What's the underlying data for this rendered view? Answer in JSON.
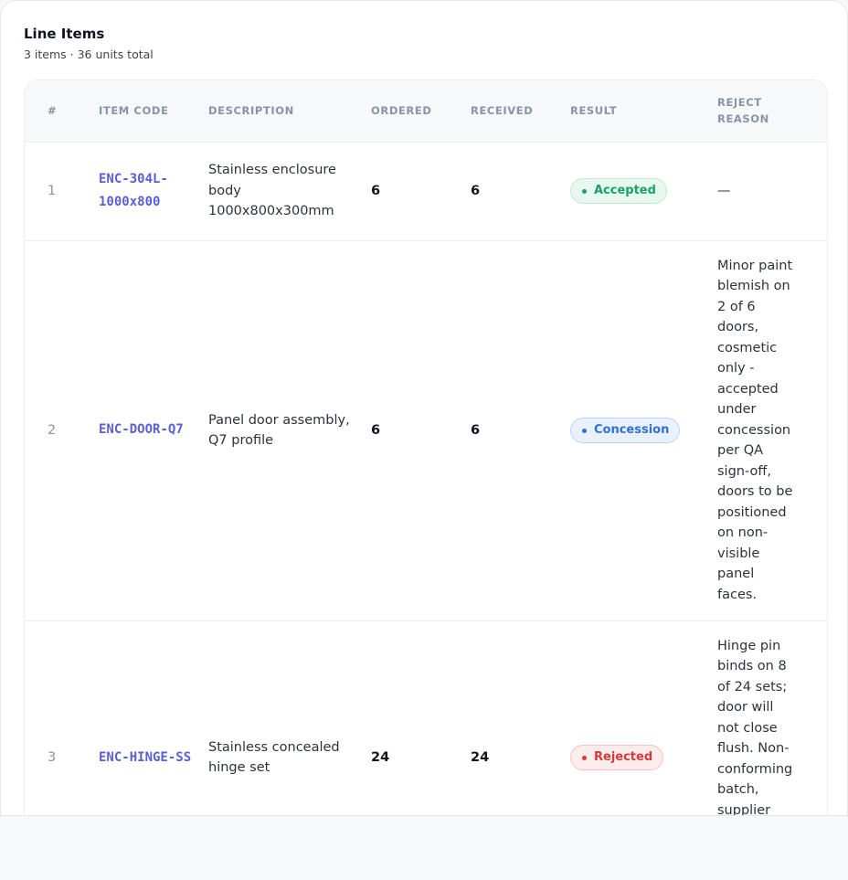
{
  "section": {
    "title": "Line Items",
    "summary": "3 items · 36 units total"
  },
  "table": {
    "columns": [
      "#",
      "ITEM CODE",
      "DESCRIPTION",
      "ORDERED",
      "RECEIVED",
      "RESULT",
      "REJECT REASON"
    ],
    "rows": [
      {
        "num": "1",
        "code": "ENC-304L-1000x800",
        "description": "Stainless enclosure body 1000x800x300mm",
        "ordered": "6",
        "received": "6",
        "result": "Accepted",
        "reason": "—"
      },
      {
        "num": "2",
        "code": "ENC-DOOR-Q7",
        "description": "Panel door assembly, Q7 profile",
        "ordered": "6",
        "received": "6",
        "result": "Concession",
        "reason": "Minor paint blemish on 2 of 6 doors, cosmetic only - accepted under concession per QA sign-off, doors to be positioned on non-visible panel faces."
      },
      {
        "num": "3",
        "code": "ENC-HINGE-SS",
        "description": "Stainless concealed hinge set",
        "ordered": "24",
        "received": "24",
        "result": "Rejected",
        "reason": "Hinge pin binds on 8 of 24 sets; door will not close flush. Non-conforming batch, supplier"
      }
    ]
  },
  "colors": {
    "accepted": "#16a36a",
    "concession": "#2f6fd8",
    "rejected": "#d63a3a",
    "item_code": "#5b5fd6"
  }
}
